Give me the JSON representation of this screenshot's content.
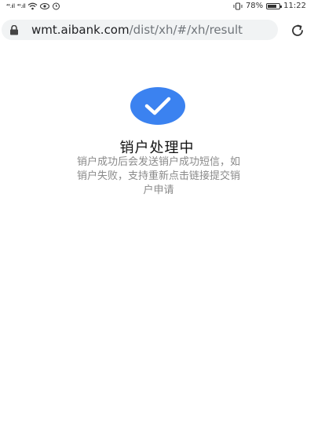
{
  "status_bar": {
    "left_signal_1": "⁴⁶.ıll",
    "left_signal_2": "⁴⁶.ıll",
    "battery_percent": "78%",
    "battery_level": 0.78,
    "time": "11:22"
  },
  "browser": {
    "url_host": "wmt.aibank.com",
    "url_path": "/dist/xh/#/xh/result",
    "lock_icon": "lock-icon",
    "reload_icon": "reload-icon"
  },
  "result": {
    "icon": "check-icon",
    "accent_color": "#3b82f0",
    "title": "销户处理中",
    "description_line1": "销户成功后会发送销户成功短信，如",
    "description_line2": "销户失败，支持重新点击链接提交销",
    "description_line3": "户申请"
  }
}
